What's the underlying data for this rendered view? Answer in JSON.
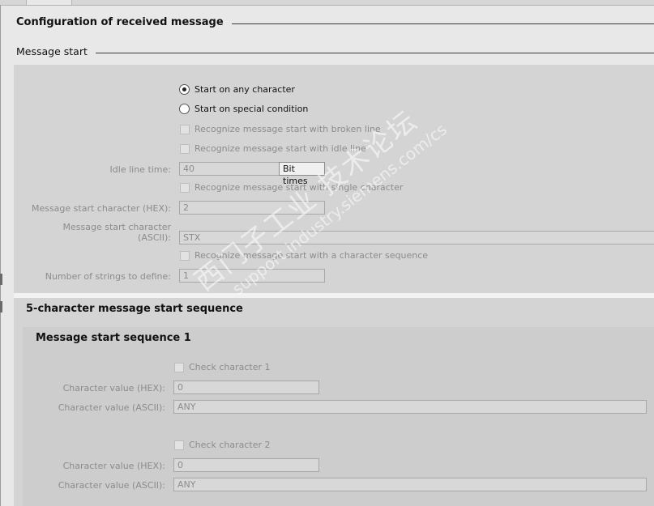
{
  "main_heading": "Configuration of received message",
  "sub_heading": "Message start",
  "radios": {
    "any_char": "Start on any character",
    "special": "Start on special condition"
  },
  "checks": {
    "broken_line": "Recognize message start with broken line",
    "idle_line": "Recognize message start with idle line",
    "single_char": "Recognize message start with single character",
    "char_seq": "Recognize message start with a character sequence"
  },
  "fields": {
    "idle_time_label": "Idle line time:",
    "idle_time_value": "40",
    "idle_time_unit": "Bit times",
    "start_hex_label": "Message start character (HEX):",
    "start_hex_value": "2",
    "start_ascii_label_1": "Message start character",
    "start_ascii_label_2": "(ASCII):",
    "start_ascii_value": "STX",
    "num_strings_label": "Number of strings to define:",
    "num_strings_value": "1"
  },
  "sequence_section": {
    "title": "5-character message start sequence",
    "sequence_title": "Message start sequence 1",
    "characters": [
      {
        "check_label": "Check character  1",
        "hex_label": "Character value (HEX):",
        "hex_value": "0",
        "ascii_label": "Character value (ASCII):",
        "ascii_value": "ANY"
      },
      {
        "check_label": "Check character  2",
        "hex_label": "Character value (HEX):",
        "hex_value": "0",
        "ascii_label": "Character value (ASCII):",
        "ascii_value": "ANY"
      }
    ]
  },
  "watermark": {
    "line1": "西门子工业  技术论坛",
    "line2": "support.industry.siemens.com/cs"
  }
}
